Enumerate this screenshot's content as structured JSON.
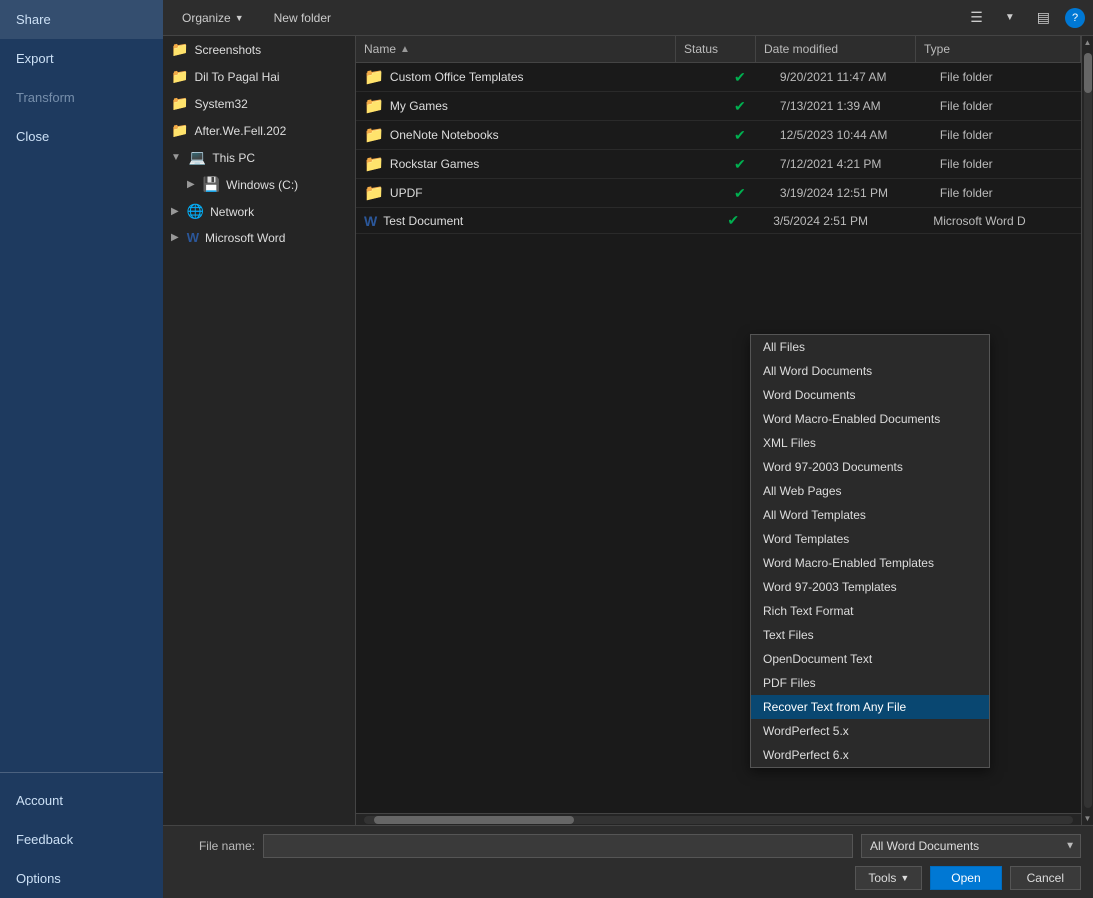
{
  "leftPanel": {
    "navItems": [
      {
        "id": "share",
        "label": "Share"
      },
      {
        "id": "export",
        "label": "Export"
      },
      {
        "id": "transform",
        "label": "Transform",
        "disabled": true
      },
      {
        "id": "close",
        "label": "Close"
      }
    ],
    "bottomItems": [
      {
        "id": "account",
        "label": "Account"
      },
      {
        "id": "feedback",
        "label": "Feedback"
      },
      {
        "id": "options",
        "label": "Options"
      }
    ]
  },
  "toolbar": {
    "organizeLabel": "Organize",
    "newFolderLabel": "New folder",
    "viewIcon": "☰",
    "layoutIcon": "▤",
    "helpIcon": "?"
  },
  "columns": {
    "name": "Name",
    "status": "Status",
    "dateModified": "Date modified",
    "type": "Type"
  },
  "files": [
    {
      "icon": "📁",
      "iconType": "folder",
      "name": "Custom Office Templates",
      "status": "✓",
      "dateModified": "9/20/2021 11:47 AM",
      "type": "File folder"
    },
    {
      "icon": "📁",
      "iconType": "folder",
      "name": "My Games",
      "status": "✓",
      "dateModified": "7/13/2021 1:39 AM",
      "type": "File folder"
    },
    {
      "icon": "📁",
      "iconType": "folder",
      "name": "OneNote Notebooks",
      "status": "✓",
      "dateModified": "12/5/2023 10:44 AM",
      "type": "File folder"
    },
    {
      "icon": "📁",
      "iconType": "folder",
      "name": "Rockstar Games",
      "status": "✓",
      "dateModified": "7/12/2021 4:21 PM",
      "type": "File folder"
    },
    {
      "icon": "📁",
      "iconType": "folder",
      "name": "UPDF",
      "status": "✓",
      "dateModified": "3/19/2024 12:51 PM",
      "type": "File folder"
    },
    {
      "icon": "W",
      "iconType": "word",
      "name": "Test Document",
      "status": "✓",
      "dateModified": "3/5/2024 2:51 PM",
      "type": "Microsoft Word D"
    }
  ],
  "sidebar": {
    "items": [
      {
        "id": "screenshots",
        "label": "Screenshots",
        "icon": "📁",
        "indent": 0
      },
      {
        "id": "dil-to-pagal",
        "label": "Dil To Pagal Hai",
        "icon": "📁",
        "indent": 0
      },
      {
        "id": "system32",
        "label": "System32",
        "icon": "📁",
        "indent": 0
      },
      {
        "id": "after-we-fell",
        "label": "After.We.Fell.202",
        "icon": "📁",
        "indent": 0
      },
      {
        "id": "this-pc",
        "label": "This PC",
        "icon": "💻",
        "indent": 0,
        "expanded": true
      },
      {
        "id": "windows-c",
        "label": "Windows (C:)",
        "icon": "💾",
        "indent": 1,
        "hasExpand": true
      },
      {
        "id": "network",
        "label": "Network",
        "icon": "🌐",
        "indent": 0,
        "hasExpand": true
      },
      {
        "id": "microsoft-word",
        "label": "Microsoft Word",
        "icon": "W",
        "indent": 0,
        "hasExpand": true
      }
    ]
  },
  "bottomBar": {
    "filenameLabel": "File name:",
    "filenameValue": "",
    "filenamePlaceholder": "",
    "fileTypeSelected": "All Word Documents",
    "toolsLabel": "Tools",
    "openLabel": "Open",
    "cancelLabel": "Cancel"
  },
  "dropdown": {
    "visible": true,
    "options": [
      {
        "id": "all-files",
        "label": "All Files"
      },
      {
        "id": "all-word-docs",
        "label": "All Word Documents"
      },
      {
        "id": "word-docs",
        "label": "Word Documents"
      },
      {
        "id": "word-macro-enabled",
        "label": "Word Macro-Enabled Documents"
      },
      {
        "id": "xml-files",
        "label": "XML Files"
      },
      {
        "id": "word-97-2003",
        "label": "Word 97-2003 Documents"
      },
      {
        "id": "all-web-pages",
        "label": "All Web Pages"
      },
      {
        "id": "all-word-templates",
        "label": "All Word Templates"
      },
      {
        "id": "word-templates",
        "label": "Word Templates"
      },
      {
        "id": "word-macro-enabled-templates",
        "label": "Word Macro-Enabled Templates"
      },
      {
        "id": "word-97-2003-templates",
        "label": "Word 97-2003 Templates"
      },
      {
        "id": "rich-text-format",
        "label": "Rich Text Format"
      },
      {
        "id": "text-files",
        "label": "Text Files"
      },
      {
        "id": "opendocument-text",
        "label": "OpenDocument Text"
      },
      {
        "id": "pdf-files",
        "label": "PDF Files"
      },
      {
        "id": "recover-text",
        "label": "Recover Text from Any File",
        "selected": true
      },
      {
        "id": "wordperfect-5x",
        "label": "WordPerfect 5.x"
      },
      {
        "id": "wordperfect-6x",
        "label": "WordPerfect 6.x"
      }
    ]
  }
}
